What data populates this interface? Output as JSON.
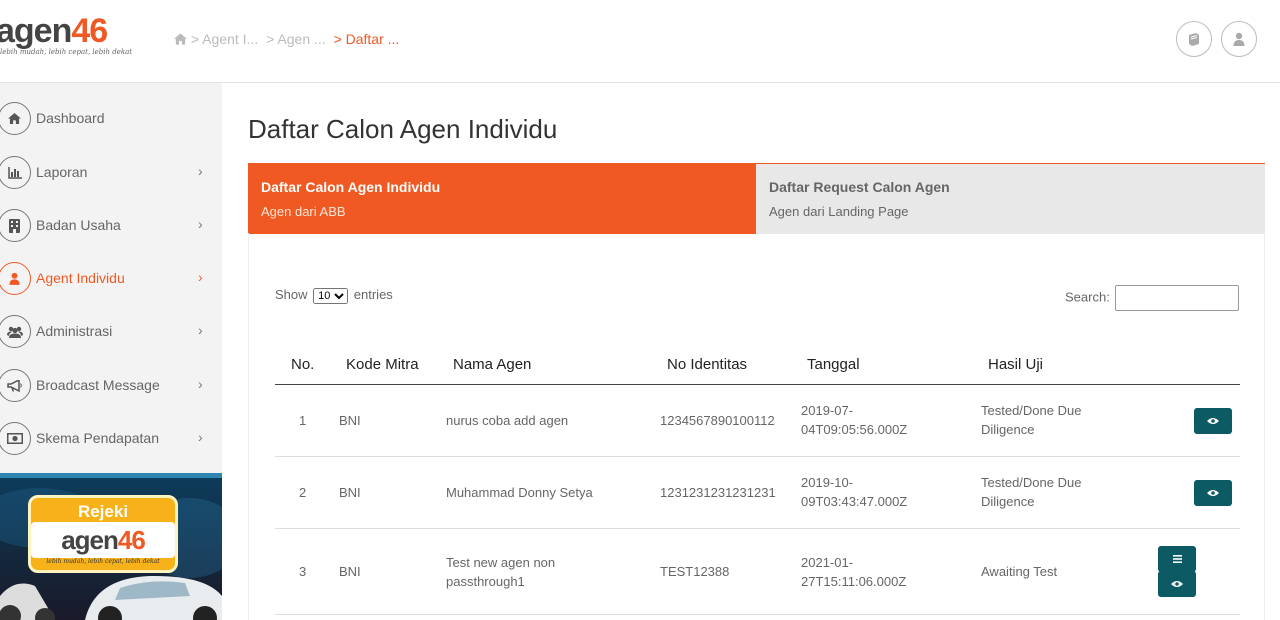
{
  "header": {
    "logo_text_a": "agen",
    "logo_text_b": "46",
    "logo_tagline": "lebih mudah, lebih cepat, lebih dekat",
    "breadcrumb": [
      {
        "label": "> Agent I..."
      },
      {
        "label": "> Agen ..."
      },
      {
        "label": "> Daftar ..."
      }
    ],
    "icons": [
      "book-icon",
      "user-icon"
    ]
  },
  "sidebar": {
    "items": [
      {
        "label": "Dashboard",
        "icon": "home-icon",
        "chevron": ""
      },
      {
        "label": "Laporan",
        "icon": "bar-chart-icon",
        "chevron": "›"
      },
      {
        "label": "Badan Usaha",
        "icon": "building-icon",
        "chevron": "›"
      },
      {
        "label": "Agent Individu",
        "icon": "user-icon",
        "chevron": "›"
      },
      {
        "label": "Administrasi",
        "icon": "users-icon",
        "chevron": "›"
      },
      {
        "label": "Broadcast Message",
        "icon": "megaphone-icon",
        "chevron": "›"
      },
      {
        "label": "Skema Pendapatan",
        "icon": "money-icon",
        "chevron": "›"
      }
    ],
    "promo": {
      "title": "Rejeki",
      "logo_a": "agen",
      "logo_b": "46",
      "tagline": "lebih mudah, lebih cepat, lebih dekat"
    }
  },
  "main": {
    "title": "Daftar Calon Agen Individu",
    "tabs": [
      {
        "title": "Daftar Calon Agen Individu",
        "subtitle": "Agen dari ABB"
      },
      {
        "title": "Daftar Request Calon Agen",
        "subtitle": "Agen dari Landing Page"
      }
    ],
    "show_prefix": "Show",
    "show_value": "10",
    "show_suffix": "entries",
    "search_label": "Search:",
    "search_value": "",
    "columns": [
      "No.",
      "Kode Mitra",
      "Nama Agen",
      "No Identitas",
      "Tanggal",
      "Hasil Uji"
    ],
    "rows": [
      {
        "no": "1",
        "kode": "BNI",
        "nama": "nurus coba add agen",
        "identitas": "1234567890100112",
        "tanggal": "2019-07-04T09:05:56.000Z",
        "hasil": "Tested/Done Due Diligence"
      },
      {
        "no": "2",
        "kode": "BNI",
        "nama": "Muhammad Donny Setya",
        "identitas": "1231231231231231",
        "tanggal": "2019-10-09T03:43:47.000Z",
        "hasil": "Tested/Done Due Diligence"
      },
      {
        "no": "3",
        "kode": "BNI",
        "nama": "Test new agen non passthrough1",
        "identitas": "TEST12388",
        "tanggal": "2021-01-27T15:11:06.000Z",
        "hasil": "Awaiting Test"
      }
    ]
  },
  "colors": {
    "accent": "#f05a22",
    "button": "#0c5a63"
  }
}
